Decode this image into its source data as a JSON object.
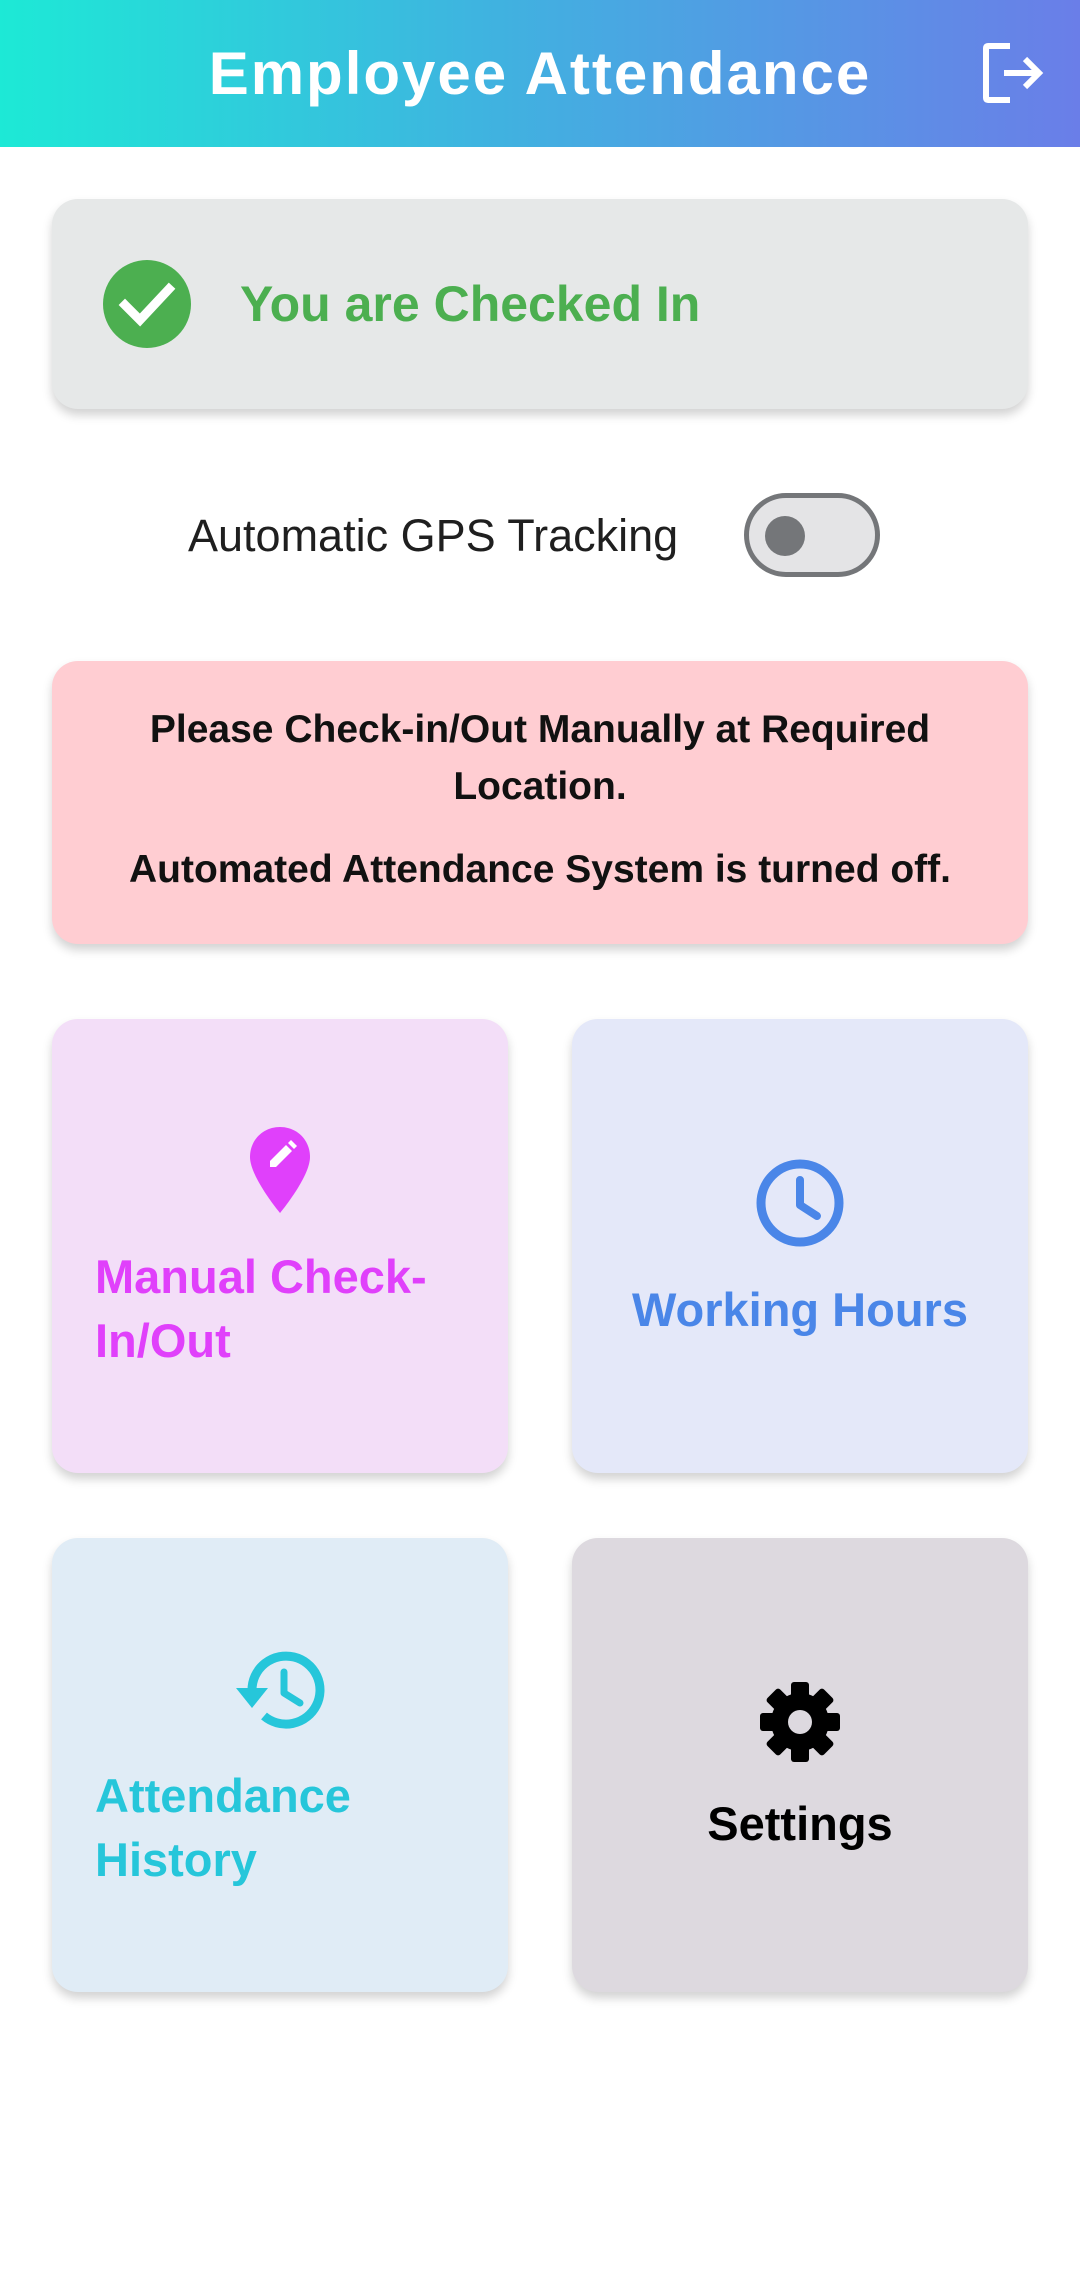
{
  "header": {
    "title": "Employee Attendance",
    "logout_icon": "logout-icon"
  },
  "status": {
    "text": "You are Checked In",
    "icon": "check-circle-icon",
    "color": "#4caf50"
  },
  "gps": {
    "label": "Automatic GPS Tracking",
    "enabled": false
  },
  "notice": {
    "line1": "Please Check-in/Out Manually at Required Location.",
    "line2": "Automated Attendance System is turned off.",
    "background": "#ffcdd2"
  },
  "tiles": [
    {
      "label_line1": "Manual Check-",
      "label_line2": "In/Out",
      "icon": "edit-location-icon",
      "color": "#e040fb"
    },
    {
      "label": "Working Hours",
      "icon": "clock-icon",
      "color": "#4a86e8"
    },
    {
      "label_line1": "Attendance",
      "label_line2": "History",
      "icon": "history-icon",
      "color": "#26c6da"
    },
    {
      "label": "Settings",
      "icon": "gear-icon",
      "color": "#000000"
    }
  ]
}
